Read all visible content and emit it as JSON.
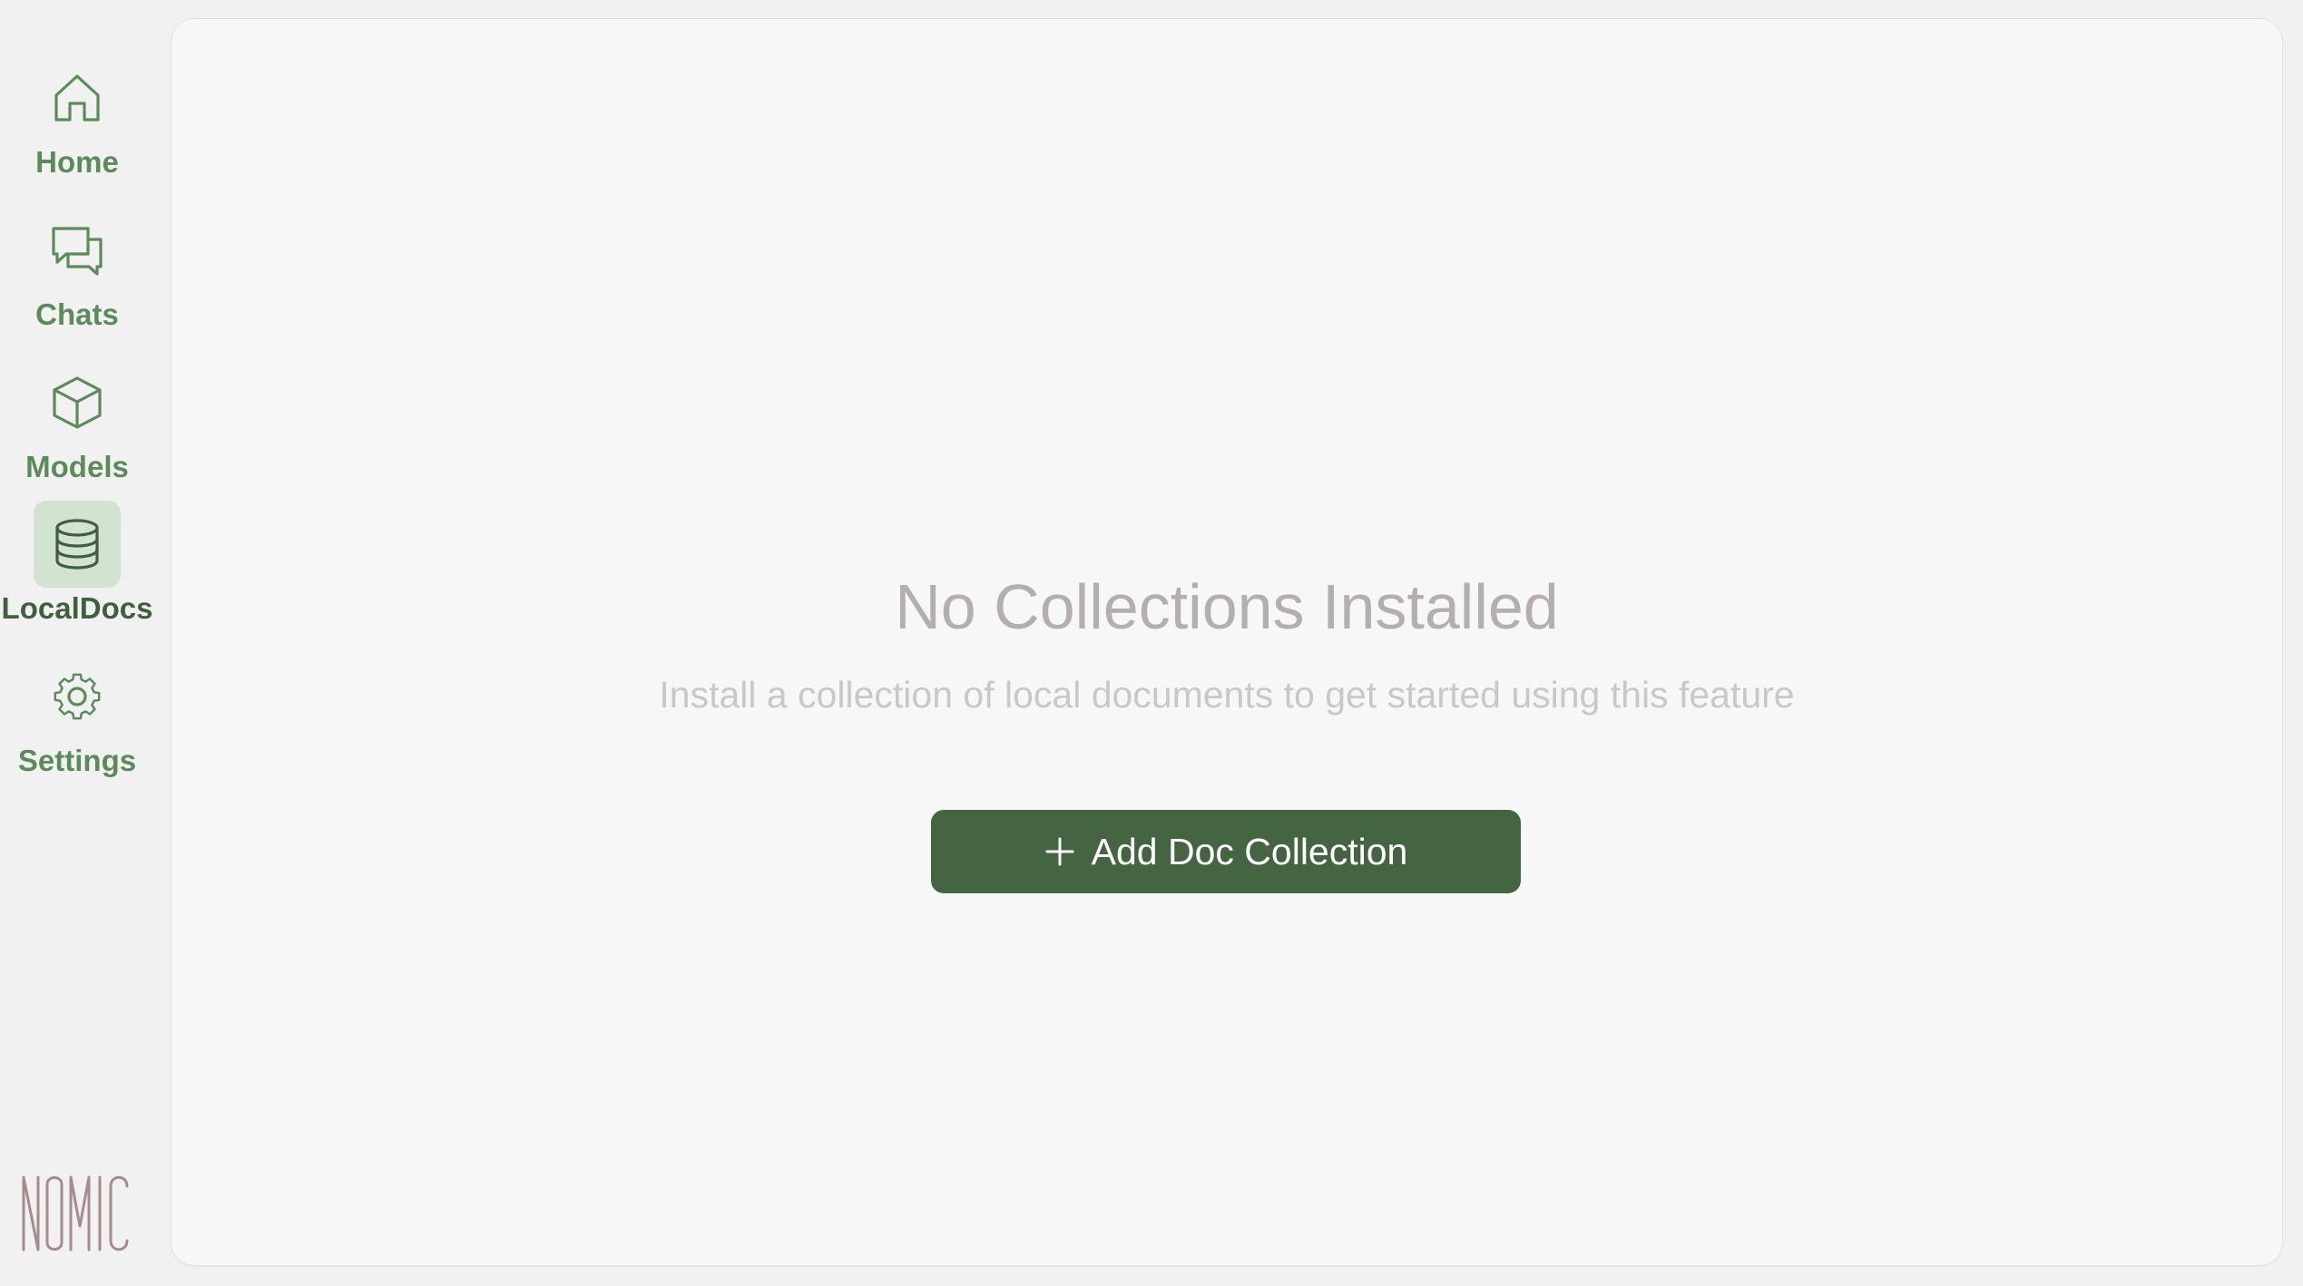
{
  "sidebar": {
    "items": [
      {
        "label": "Home",
        "icon": "home-icon",
        "active": false
      },
      {
        "label": "Chats",
        "icon": "chat-bubbles-icon",
        "active": false
      },
      {
        "label": "Models",
        "icon": "cube-icon",
        "active": false
      },
      {
        "label": "LocalDocs",
        "icon": "database-icon",
        "active": true
      },
      {
        "label": "Settings",
        "icon": "gear-icon",
        "active": false
      }
    ],
    "logo": "nomic-logo"
  },
  "main": {
    "empty_title": "No Collections Installed",
    "empty_subtitle": "Install a collection of local documents to get started using this feature",
    "add_button_label": "Add Doc Collection",
    "add_button_icon": "plus-icon"
  },
  "colors": {
    "accent": "#5d8a5b",
    "accent_dark": "#3f5f3d",
    "active_bg": "#d3e3d2",
    "button_bg": "#456542",
    "title_text": "#b4aeae",
    "subtitle_text": "#cbc7c7",
    "logo": "#a58b8e"
  }
}
